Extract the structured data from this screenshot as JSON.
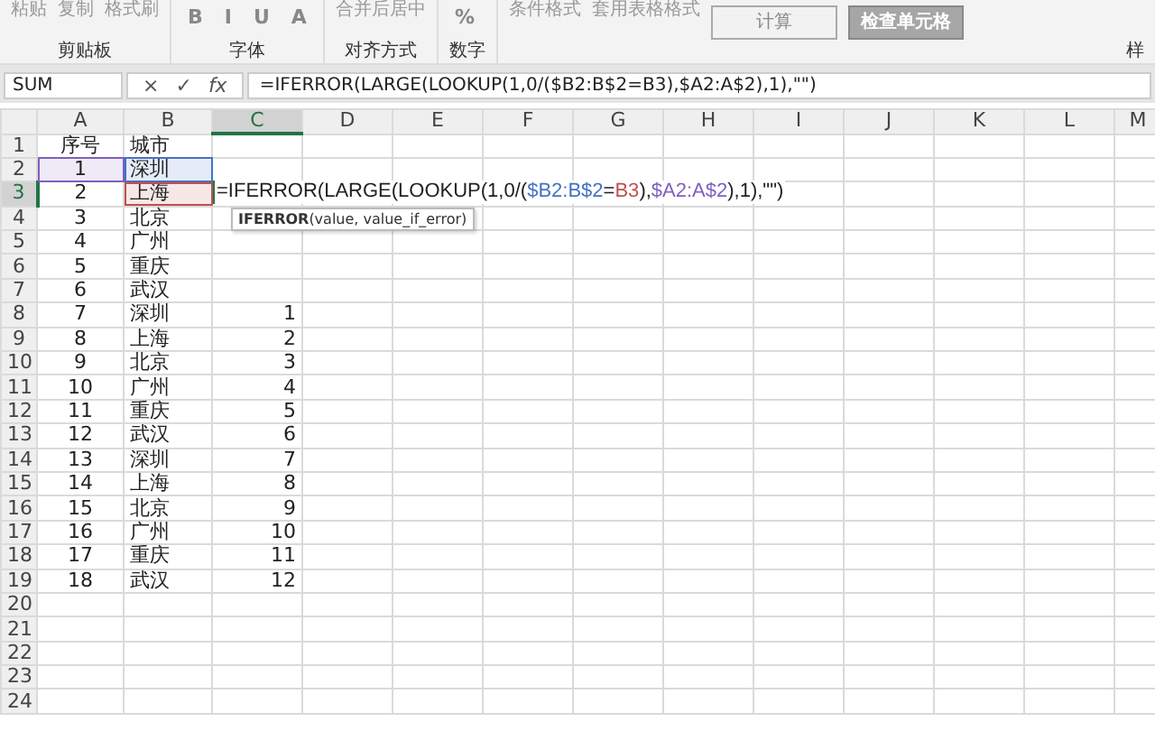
{
  "ribbon": {
    "groups": [
      {
        "label": "剪贴板",
        "items": [
          {
            "kind": "big",
            "text": "粘贴"
          },
          {
            "kind": "small",
            "text": "复制"
          },
          {
            "kind": "small",
            "text": "格式刷"
          }
        ]
      },
      {
        "label": "字体",
        "items": [
          {
            "kind": "glyph",
            "text": "B"
          },
          {
            "kind": "glyph",
            "text": "I"
          },
          {
            "kind": "glyph",
            "text": "U"
          },
          {
            "kind": "glyph",
            "text": "A"
          }
        ]
      },
      {
        "label": "对齐方式",
        "items": [
          {
            "kind": "small",
            "text": "合并后居中"
          }
        ]
      },
      {
        "label": "数字",
        "items": [
          {
            "kind": "glyph",
            "text": "%"
          }
        ]
      },
      {
        "label": "样",
        "items": [
          {
            "kind": "small",
            "text": "条件格式"
          },
          {
            "kind": "small",
            "text": "套用表格格式"
          },
          {
            "kind": "style",
            "text": "计算"
          },
          {
            "kind": "style-dark",
            "text": "检查单元格"
          }
        ]
      }
    ]
  },
  "name_box": "SUM",
  "formula_bar": {
    "cancel": "×",
    "enter": "✓",
    "fx": "fx",
    "formula": "=IFERROR(LARGE(LOOKUP(1,0/($B2:B$2=B3),$A2:A$2),1),\"\")"
  },
  "columns": [
    {
      "label": "A",
      "selected": false
    },
    {
      "label": "B",
      "selected": false
    },
    {
      "label": "C",
      "selected": true
    },
    {
      "label": "D",
      "selected": false
    },
    {
      "label": "E",
      "selected": false
    },
    {
      "label": "F",
      "selected": false
    },
    {
      "label": "G",
      "selected": false
    },
    {
      "label": "H",
      "selected": false
    },
    {
      "label": "I",
      "selected": false
    },
    {
      "label": "J",
      "selected": false
    },
    {
      "label": "K",
      "selected": false
    },
    {
      "label": "L",
      "selected": false
    },
    {
      "label": "M",
      "selected": false
    }
  ],
  "rows": [
    {
      "number": "1",
      "selected": false,
      "cells": [
        {
          "text": "序号"
        },
        {
          "text": "城市"
        },
        {
          "text": ""
        }
      ]
    },
    {
      "number": "2",
      "selected": false,
      "cells": [
        {
          "text": "1",
          "color": "#7f5fbf"
        },
        {
          "text": "深圳",
          "color": "#4472c4"
        },
        {
          "text": ""
        }
      ]
    },
    {
      "number": "3",
      "selected": true,
      "cells": [
        {
          "text": "2"
        },
        {
          "text": "上海",
          "color": "#c0504d"
        },
        {
          "kind": "editing"
        }
      ]
    },
    {
      "number": "4",
      "selected": false,
      "cells": [
        {
          "text": "3"
        },
        {
          "text": "北京"
        },
        {
          "text": ""
        }
      ]
    },
    {
      "number": "5",
      "selected": false,
      "cells": [
        {
          "text": "4"
        },
        {
          "text": "广州"
        },
        {
          "text": ""
        }
      ]
    },
    {
      "number": "6",
      "selected": false,
      "cells": [
        {
          "text": "5"
        },
        {
          "text": "重庆"
        },
        {
          "text": ""
        }
      ]
    },
    {
      "number": "7",
      "selected": false,
      "cells": [
        {
          "text": "6"
        },
        {
          "text": "武汉"
        },
        {
          "text": ""
        }
      ]
    },
    {
      "number": "8",
      "selected": false,
      "cells": [
        {
          "text": "7"
        },
        {
          "text": "深圳"
        },
        {
          "text": "1"
        }
      ]
    },
    {
      "number": "9",
      "selected": false,
      "cells": [
        {
          "text": "8"
        },
        {
          "text": "上海"
        },
        {
          "text": "2"
        }
      ]
    },
    {
      "number": "10",
      "selected": false,
      "cells": [
        {
          "text": "9"
        },
        {
          "text": "北京"
        },
        {
          "text": "3"
        }
      ]
    },
    {
      "number": "11",
      "selected": false,
      "cells": [
        {
          "text": "10"
        },
        {
          "text": "广州"
        },
        {
          "text": "4"
        }
      ]
    },
    {
      "number": "12",
      "selected": false,
      "cells": [
        {
          "text": "11"
        },
        {
          "text": "重庆"
        },
        {
          "text": "5"
        }
      ]
    },
    {
      "number": "13",
      "selected": false,
      "cells": [
        {
          "text": "12"
        },
        {
          "text": "武汉"
        },
        {
          "text": "6"
        }
      ]
    },
    {
      "number": "14",
      "selected": false,
      "cells": [
        {
          "text": "13"
        },
        {
          "text": "深圳"
        },
        {
          "text": "7"
        }
      ]
    },
    {
      "number": "15",
      "selected": false,
      "cells": [
        {
          "text": "14"
        },
        {
          "text": "上海"
        },
        {
          "text": "8"
        }
      ]
    },
    {
      "number": "16",
      "selected": false,
      "cells": [
        {
          "text": "15"
        },
        {
          "text": "北京"
        },
        {
          "text": "9"
        }
      ]
    },
    {
      "number": "17",
      "selected": false,
      "cells": [
        {
          "text": "16"
        },
        {
          "text": "广州"
        },
        {
          "text": "10"
        }
      ]
    },
    {
      "number": "18",
      "selected": false,
      "cells": [
        {
          "text": "17"
        },
        {
          "text": "重庆"
        },
        {
          "text": "11"
        }
      ]
    },
    {
      "number": "19",
      "selected": false,
      "cells": [
        {
          "text": "18"
        },
        {
          "text": "武汉"
        },
        {
          "text": "12"
        }
      ]
    },
    {
      "number": "20",
      "selected": false,
      "cells": []
    },
    {
      "number": "21",
      "selected": false,
      "cells": []
    },
    {
      "number": "22",
      "selected": false,
      "cells": []
    },
    {
      "number": "23",
      "selected": false,
      "cells": []
    },
    {
      "number": "24",
      "selected": false,
      "cells": []
    }
  ],
  "cell_editor": {
    "segments": [
      {
        "text": "=IFERROR(LARGE(LOOKUP(1,0/("
      },
      {
        "text": "$B2:B$2",
        "color": "#4472c4"
      },
      {
        "text": "="
      },
      {
        "text": "B3",
        "color": "#c0504d"
      },
      {
        "text": "),"
      },
      {
        "text": "$A2:A$2",
        "color": "#7f5fbf"
      },
      {
        "text": "),1),\"\")"
      }
    ],
    "tooltip": "**IFERROR**(value, value_if_error)"
  }
}
